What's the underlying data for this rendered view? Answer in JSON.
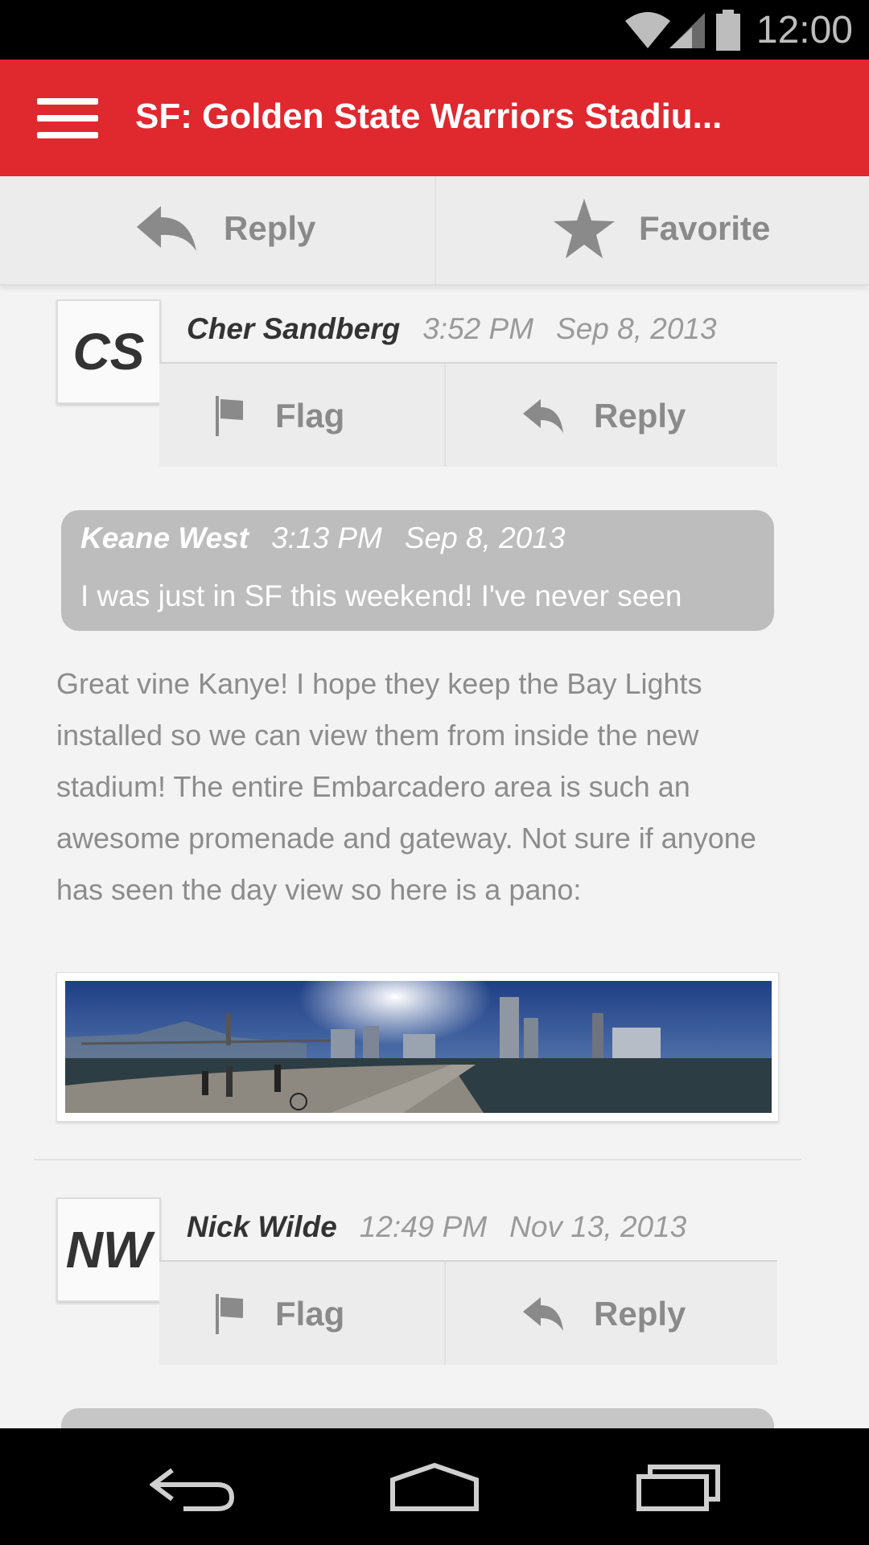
{
  "status_bar": {
    "time": "12:00"
  },
  "app_bar": {
    "title": "SF: Golden State Warriors Stadiu..."
  },
  "action_bar": {
    "reply_label": "Reply",
    "favorite_label": "Favorite"
  },
  "comments": [
    {
      "initials": "CS",
      "author": "Cher Sandberg",
      "time": "3:52 PM",
      "date": "Sep 8, 2013",
      "flag_label": "Flag",
      "reply_label": "Reply",
      "quote": {
        "author": "Keane West",
        "time": "3:13 PM",
        "date": "Sep 8, 2013",
        "text": "I was just in SF this weekend! I've never seen"
      },
      "body": "Great vine Kanye! I hope they keep the Bay Lights installed so we can view them from inside the new stadium! The entire Embarcadero area is such an awesome promenade and gateway. Not sure if anyone has seen the day view so here is a pano:"
    },
    {
      "initials": "NW",
      "author": "Nick Wilde",
      "time": "12:49 PM",
      "date": "Nov 13, 2013",
      "flag_label": "Flag",
      "reply_label": "Reply"
    }
  ],
  "colors": {
    "accent": "#e0282f",
    "background": "#f3f3f3"
  },
  "icons": [
    "menu-icon",
    "reply-icon",
    "star-icon",
    "flag-icon",
    "back-icon",
    "home-icon",
    "recents-icon",
    "wifi-icon",
    "signal-icon",
    "battery-icon"
  ]
}
